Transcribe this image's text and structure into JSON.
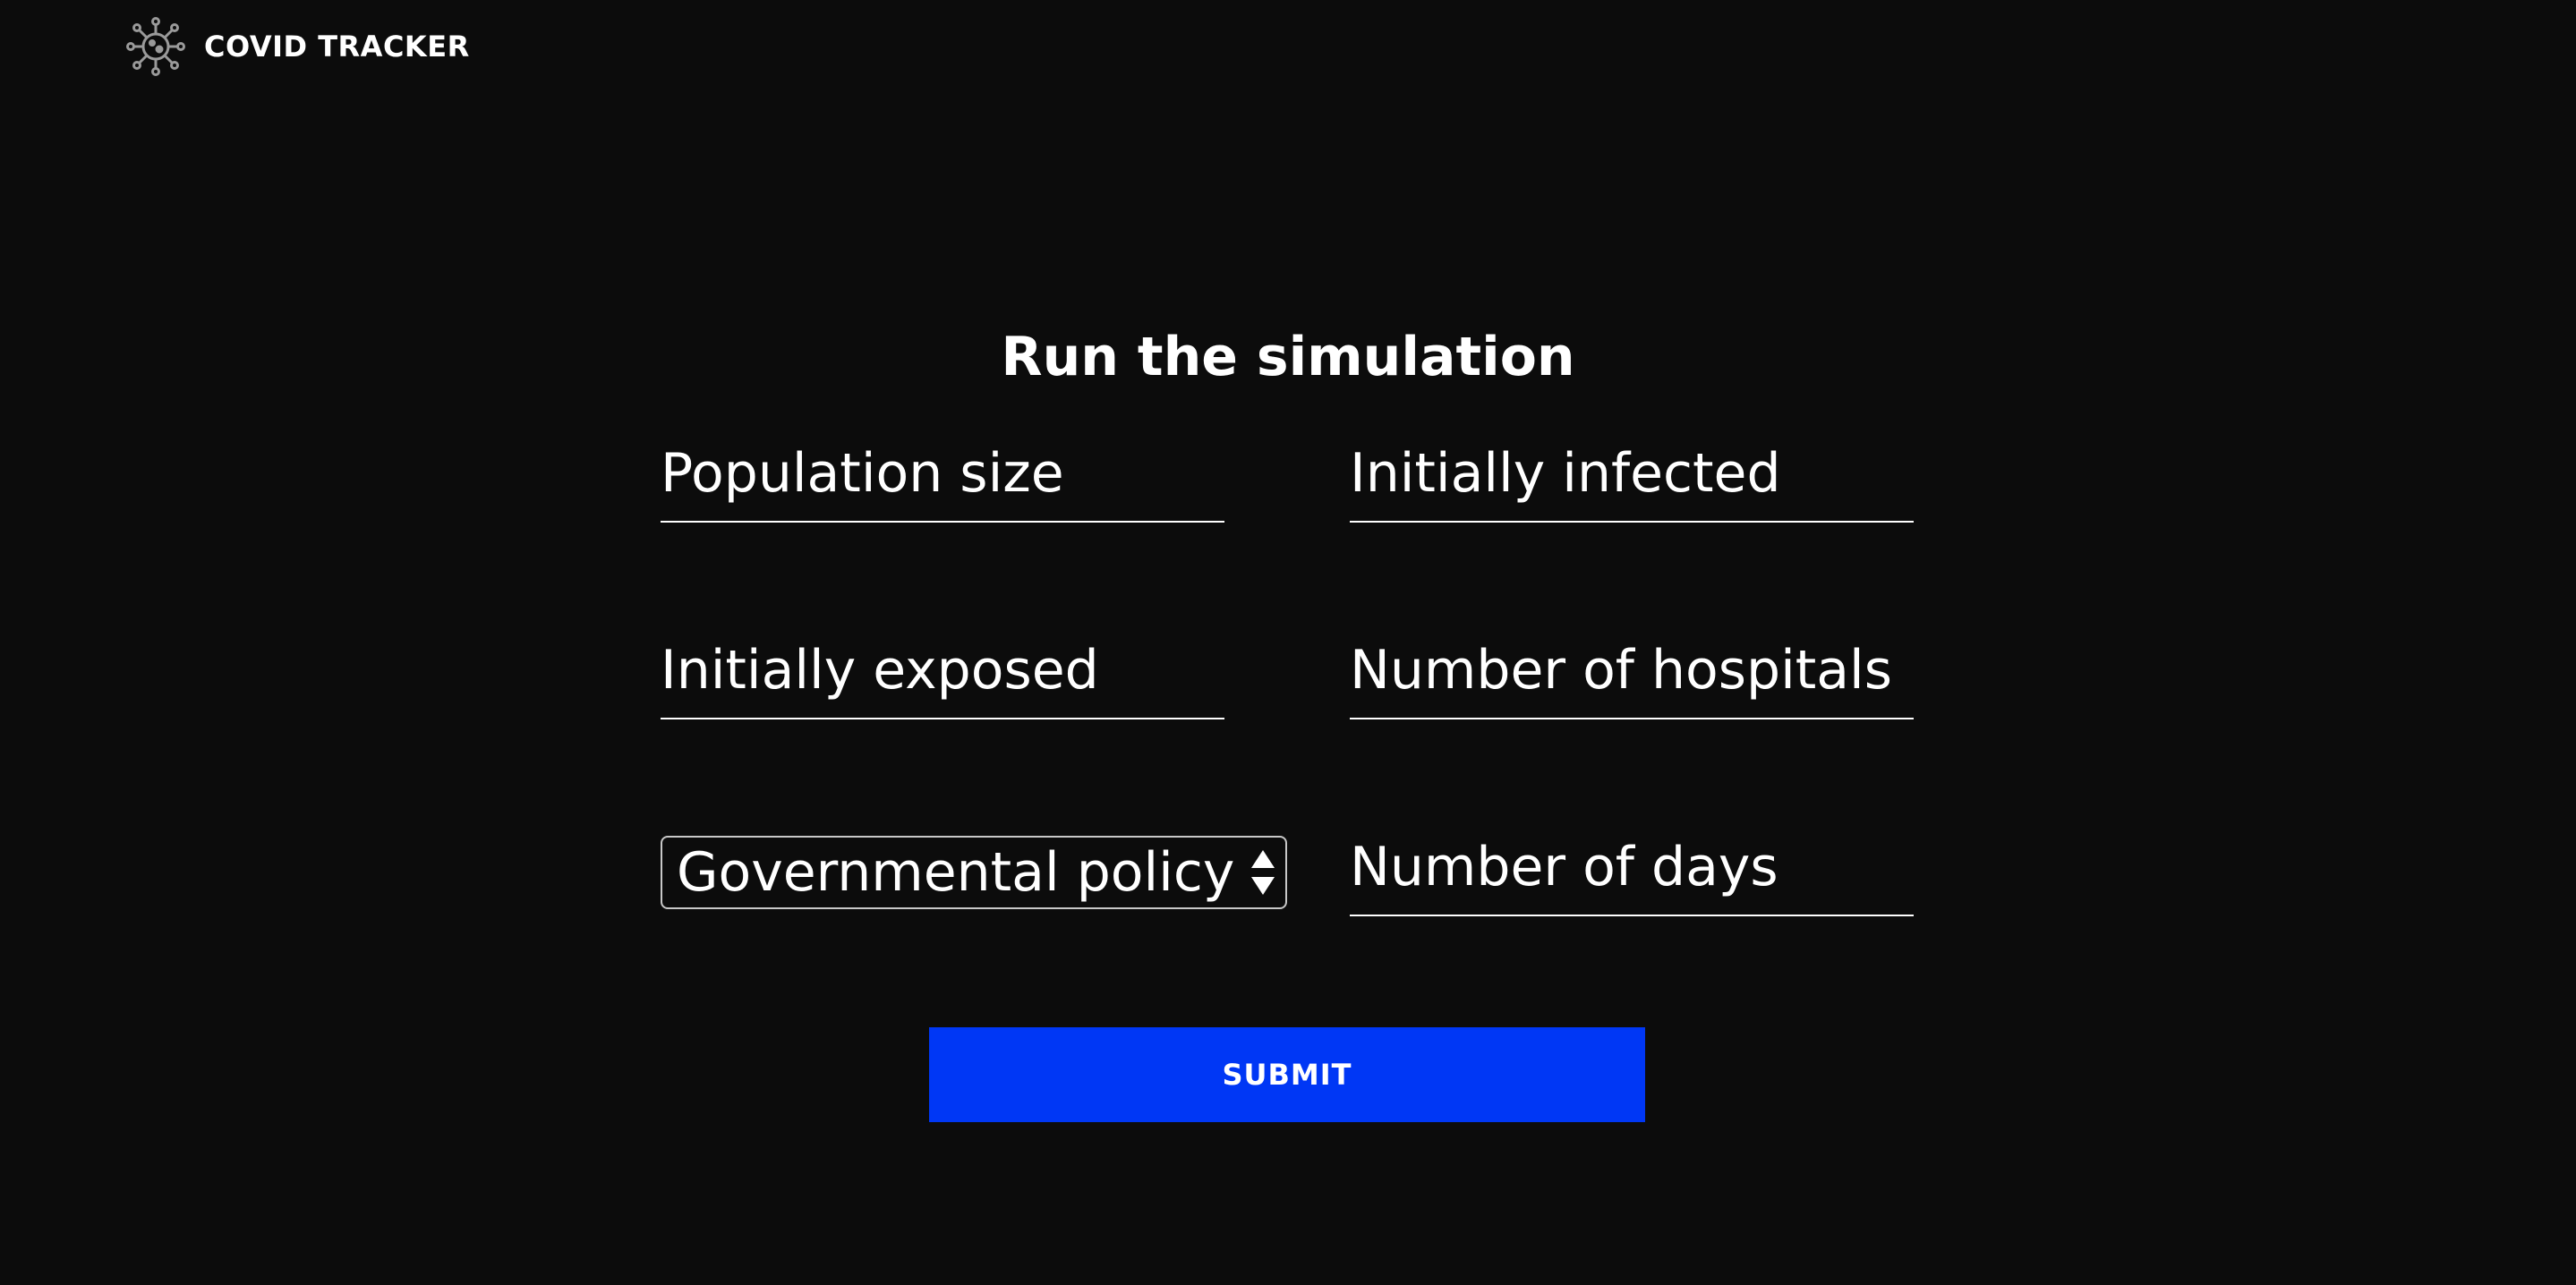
{
  "header": {
    "logo_icon": "virus-icon",
    "brand_name": "COVID TRACKER"
  },
  "main": {
    "title": "Run the simulation",
    "fields": {
      "population_size": {
        "placeholder": "Population size",
        "value": ""
      },
      "initially_infected": {
        "placeholder": "Initially infected",
        "value": ""
      },
      "initially_exposed": {
        "placeholder": "Initially exposed",
        "value": ""
      },
      "number_of_hospitals": {
        "placeholder": "Number of hospitals",
        "value": ""
      },
      "number_of_days": {
        "placeholder": "Number of days",
        "value": ""
      }
    },
    "policy_select": {
      "selected": "Governmental policy",
      "icon": "select-arrows-icon"
    },
    "submit_label": "SUBMIT"
  },
  "colors": {
    "background": "#0c0c0c",
    "text": "#ffffff",
    "accent": "#0037f5",
    "logo_gray": "#9a9a9a"
  }
}
